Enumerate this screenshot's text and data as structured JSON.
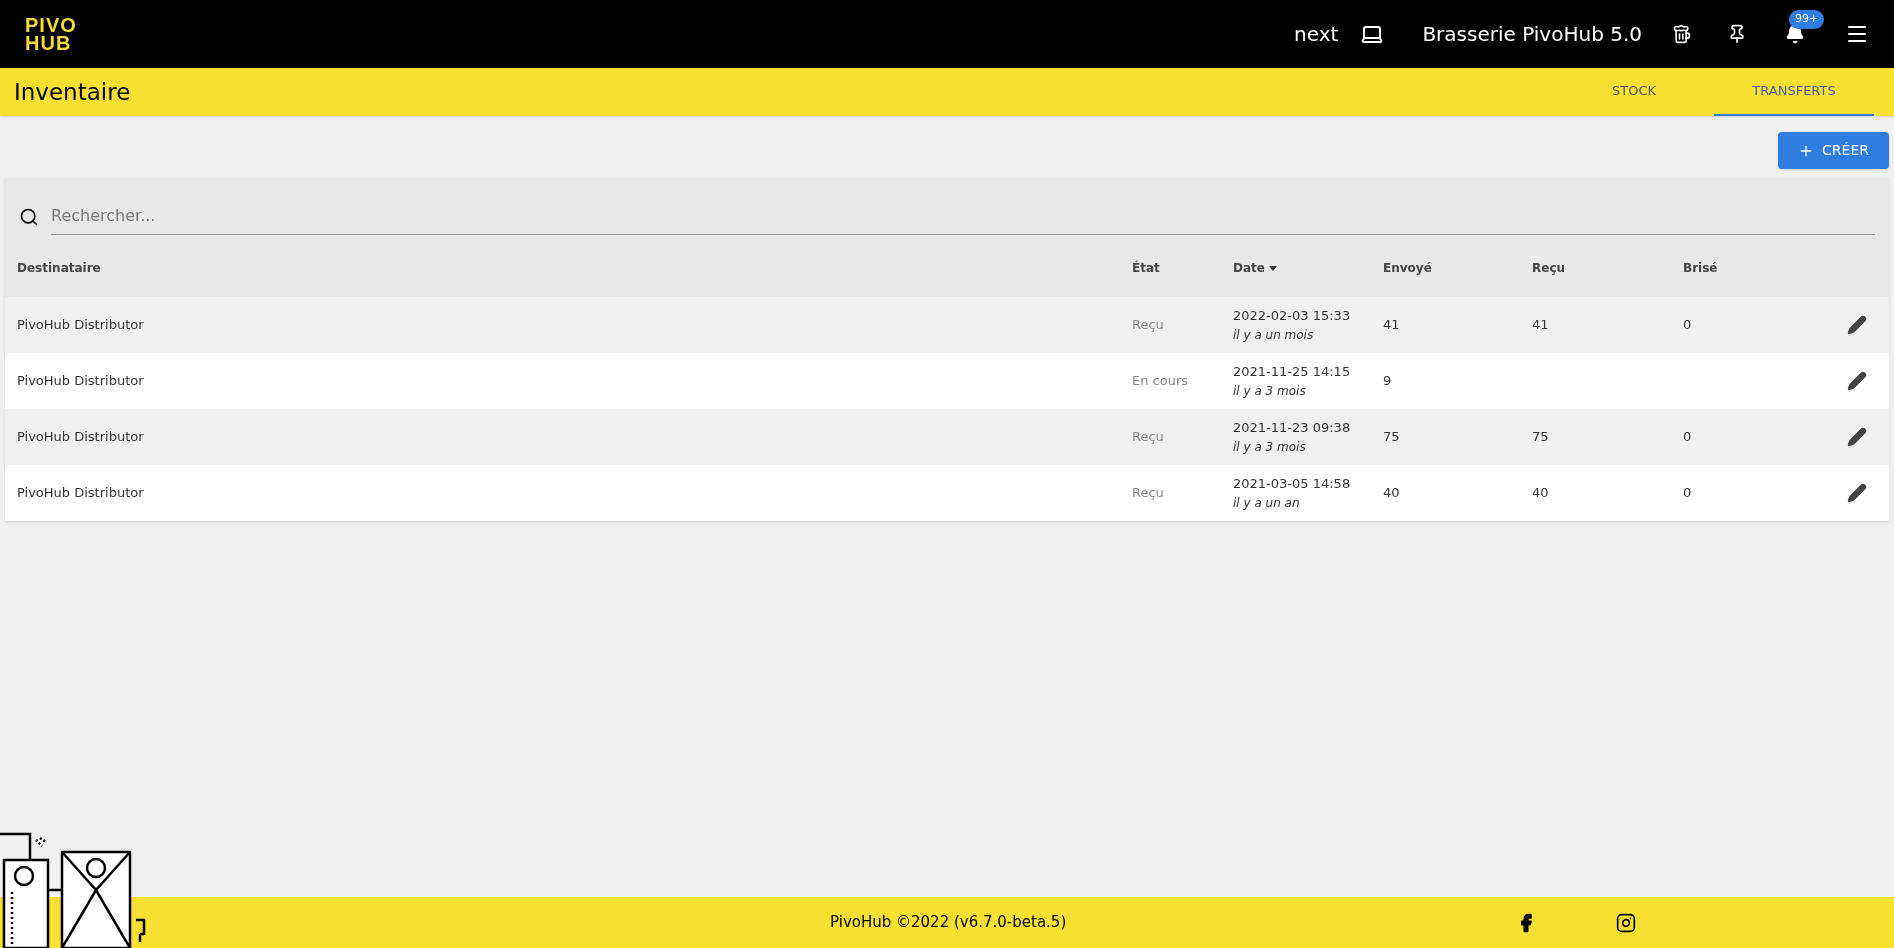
{
  "topbar": {
    "logo": [
      "PIVO",
      "HUB"
    ],
    "env": "next",
    "brewery": "Brasserie PivoHub 5.0",
    "notifications_badge": "99+"
  },
  "page": {
    "title": "Inventaire",
    "tabs": [
      {
        "label": "STOCK",
        "selected": false
      },
      {
        "label": "TRANSFERTS",
        "selected": true
      }
    ]
  },
  "create_button": "CRÉER",
  "search": {
    "placeholder": "Rechercher..."
  },
  "table": {
    "columns": [
      {
        "label": "Destinataire",
        "sorted": false
      },
      {
        "label": "État",
        "sorted": false
      },
      {
        "label": "Date",
        "sorted": true
      },
      {
        "label": "Envoyé",
        "sorted": false
      },
      {
        "label": "Reçu",
        "sorted": false
      },
      {
        "label": "Brisé",
        "sorted": false
      }
    ],
    "rows": [
      {
        "recipient": "PivoHub Distributor",
        "status": "Reçu",
        "date": "2022-02-03 15:33",
        "ago": "il y a un mois",
        "sent": "41",
        "received": "41",
        "broken": "0"
      },
      {
        "recipient": "PivoHub Distributor",
        "status": "En cours",
        "date": "2021-11-25 14:15",
        "ago": "il y a 3 mois",
        "sent": "9",
        "received": "",
        "broken": ""
      },
      {
        "recipient": "PivoHub Distributor",
        "status": "Reçu",
        "date": "2021-11-23 09:38",
        "ago": "il y a 3 mois",
        "sent": "75",
        "received": "75",
        "broken": "0"
      },
      {
        "recipient": "PivoHub Distributor",
        "status": "Reçu",
        "date": "2021-03-05 14:58",
        "ago": "il y a un an",
        "sent": "40",
        "received": "40",
        "broken": "0"
      }
    ]
  },
  "footer": {
    "text": "PivoHub ©2022 (v6.7.0-beta.5)"
  }
}
